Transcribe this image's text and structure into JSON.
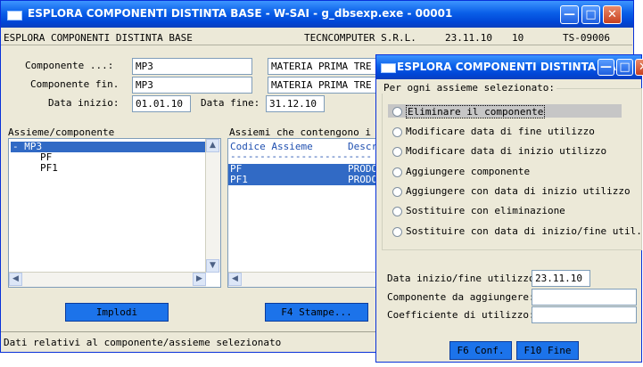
{
  "main": {
    "title": "ESPLORA COMPONENTI DISTINTA BASE  - W-SAI - g_dbsexp.exe      - 00001",
    "header_program": "ESPLORA COMPONENTI DISTINTA BASE",
    "header_company": "TECNCOMPUTER S.R.L.",
    "header_date": "23.11.10",
    "header_number": "10",
    "header_code": "TS-09006",
    "componente_label": "Componente ...:",
    "componente_value": "MP3",
    "componente_desc": "MATERIA PRIMA TRE",
    "componente_fin_label": "Componente fin.",
    "componente_fin_value": "MP3",
    "componente_fin_desc": "MATERIA PRIMA TRE",
    "data_inizio_label": "Data inizio:",
    "data_inizio_value": "01.01.10",
    "data_fine_label": "Data fine:",
    "data_fine_value": "31.12.10",
    "tree_label": "Assieme/componente",
    "tree_items": [
      "- MP3",
      "PF",
      "PF1"
    ],
    "assiemi_label": "Assiemi che contengono i",
    "assiemi_col1": "Codice Assieme",
    "assiemi_col2": "Descr",
    "assiemi_dashes": "------------------------",
    "assiemi_rows": [
      {
        "code": "PF",
        "desc": "PRODO"
      },
      {
        "code": "PF1",
        "desc": "PRODO"
      }
    ],
    "implodi_label": "Implodi",
    "stampe_label": "F4 Stampe...",
    "status": "Dati relativi al componente/assieme selezionato"
  },
  "dialog": {
    "title": "ESPLORA COMPONENTI DISTINTA BASE ...",
    "group_label": "Per ogni assieme selezionato:",
    "options": [
      "Eliminare il componente",
      "Modificare data di fine utilizzo",
      "Modificare data di inizio utilizzo",
      "Aggiungere componente",
      "Aggiungere con data di inizio utilizzo",
      "Sostituire con eliminazione",
      "Sostituire con data di inizio/fine util."
    ],
    "selected_option": 0,
    "data_label": "Data inizio/fine utilizzo:",
    "data_value": "23.11.10",
    "componente_label": "Componente da aggiungere:",
    "componente_value": "",
    "coeff_label": "Coefficiente di utilizzo:",
    "coeff_value": "",
    "conf_label": "F6 Conf.",
    "fine_label": "F10 Fine"
  },
  "colors": {
    "titlebar": "#0a5fe8",
    "selection": "#316ac5",
    "button": "#1c73ea",
    "window_bg": "#ece9d8"
  }
}
